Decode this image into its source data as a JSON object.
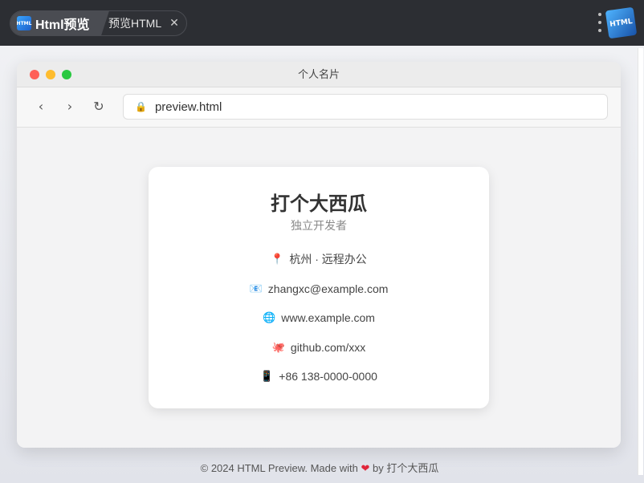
{
  "app": {
    "active_tab": "Html预览",
    "tab_icon_text": "HTML",
    "second_tab": "预览HTML",
    "close_glyph": "✕",
    "logo_text": "HTML"
  },
  "window": {
    "title": "个人名片",
    "back_glyph": "‹",
    "forward_glyph": "›",
    "reload_glyph": "↻",
    "lock_glyph": "🔒",
    "url": "preview.html"
  },
  "card": {
    "name": "打个大西瓜",
    "role": "独立开发者",
    "items": [
      {
        "icon": "📍",
        "icon_name": "location-pin-icon",
        "text": "杭州 · 远程办公"
      },
      {
        "icon": "📧",
        "icon_name": "email-icon",
        "text": "zhangxc@example.com"
      },
      {
        "icon": "🌐",
        "icon_name": "globe-icon",
        "text": "www.example.com"
      },
      {
        "icon": "🐙",
        "icon_name": "github-octopus-icon",
        "text": "github.com/xxx"
      },
      {
        "icon": "📱",
        "icon_name": "phone-icon",
        "text": "+86 138-0000-0000"
      }
    ]
  },
  "footer": {
    "prefix": "© 2024 HTML Preview. Made with",
    "heart": "❤",
    "suffix": "by 打个大西瓜"
  },
  "colors": {
    "topbar": "#2c2e33",
    "accent_red": "#fe5f57",
    "accent_yellow": "#febc2e",
    "accent_green": "#28c840",
    "heart": "#e0263a"
  }
}
